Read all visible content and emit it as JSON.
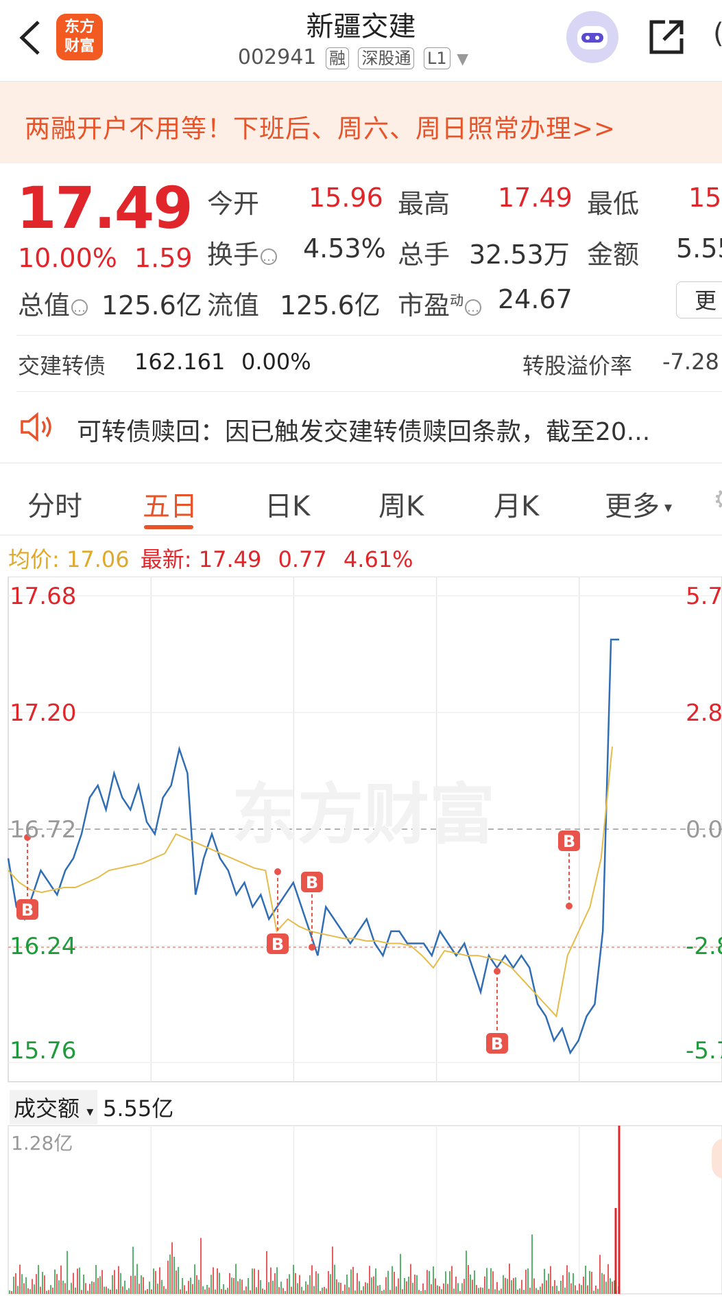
{
  "header": {
    "logo_line1": "东方",
    "logo_line2": "财富",
    "title": "新疆交建",
    "code": "002941",
    "tags": [
      "融",
      "深股通",
      "L1"
    ]
  },
  "banner": {
    "text": "两融开户不用等！下班后、周六、周日照常办理>>"
  },
  "quote": {
    "price": "17.49",
    "change_pct": "10.00%",
    "change": "1.59",
    "open_label": "今开",
    "open": "15.96",
    "high_label": "最高",
    "high": "17.49",
    "low_label": "最低",
    "low": "15",
    "turnover_label": "换手",
    "turnover": "4.53%",
    "volume_label": "总手",
    "volume": "32.53万",
    "amount_label": "金额",
    "amount": "5.55",
    "mktcap_label": "总值",
    "mktcap": "125.6亿",
    "float_label": "流值",
    "float": "125.6亿",
    "pe_label": "市盈",
    "pe_sup": "动",
    "pe": "24.67",
    "more": "更"
  },
  "bond": {
    "name": "交建转债",
    "price": "162.161",
    "pct": "0.00%",
    "premium_label": "转股溢价率",
    "premium": "-7.28"
  },
  "notice": {
    "text": "可转债赎回：因已触发交建转债赎回条款，截至20..."
  },
  "tabs": [
    "分时",
    "五日",
    "日K",
    "周K",
    "月K",
    "更多"
  ],
  "active_tab": "五日",
  "legend": {
    "avg_label": "均价:",
    "avg": "17.06",
    "last_label": "最新:",
    "last": "17.49",
    "chg": "0.77",
    "pct": "4.61%"
  },
  "chart_data": {
    "type": "line",
    "title": "",
    "y_left_ticks": [
      "17.68",
      "17.20",
      "16.72",
      "16.24",
      "15.76"
    ],
    "y_right_ticks": [
      "5.7",
      "2.8",
      "0.0",
      "-2.8",
      "-5.7"
    ],
    "ylim": [
      15.76,
      17.68
    ],
    "prev_close": 16.72,
    "day_count": 5,
    "series": [
      {
        "values": [
          16.6,
          16.4,
          16.35,
          16.45,
          16.55,
          16.5,
          16.45,
          16.55,
          16.6,
          16.7,
          16.85,
          16.9,
          16.8,
          16.95,
          16.85,
          16.8,
          16.9,
          16.75,
          16.7,
          16.85,
          16.9,
          17.05,
          16.95,
          16.45,
          16.6,
          16.7,
          16.6,
          16.55,
          16.45,
          16.5,
          16.4,
          16.45,
          16.35,
          16.4,
          16.45,
          16.5,
          16.4,
          16.3,
          16.2,
          16.4,
          16.35,
          16.3,
          16.25,
          16.3,
          16.35,
          16.25,
          16.2,
          16.3,
          16.3,
          16.25,
          16.25,
          16.25,
          16.2,
          16.3,
          16.25,
          16.2,
          16.25,
          16.15,
          16.05,
          16.2,
          16.15,
          16.2,
          16.15,
          16.2,
          16.15,
          16.0,
          15.95,
          15.85,
          15.9,
          15.8,
          15.85,
          15.95,
          16.0,
          16.3,
          17.5,
          17.5
        ],
        "color": "#2f6db5"
      },
      {
        "values": [
          16.55,
          16.5,
          16.47,
          16.46,
          16.47,
          16.48,
          16.48,
          16.5,
          16.52,
          16.55,
          16.56,
          16.57,
          16.58,
          16.6,
          16.62,
          16.7,
          16.68,
          16.66,
          16.64,
          16.62,
          16.6,
          16.58,
          16.56,
          16.55,
          16.3,
          16.35,
          16.32,
          16.3,
          16.29,
          16.28,
          16.27,
          16.27,
          16.26,
          16.26,
          16.25,
          16.25,
          16.24,
          16.2,
          16.15,
          16.22,
          16.21,
          16.2,
          16.2,
          16.19,
          16.18,
          16.15,
          16.1,
          16.05,
          16.0,
          15.95,
          16.2,
          16.3,
          16.4,
          16.6,
          17.06
        ],
        "color": "#e5bb4a"
      }
    ],
    "markers": [
      {
        "label": "B",
        "day": 0
      },
      {
        "label": "B",
        "day": 1
      },
      {
        "label": "B",
        "day": 2
      },
      {
        "label": "B",
        "day": 3
      },
      {
        "label": "B",
        "day": 3
      }
    ]
  },
  "volume": {
    "label": "成交额",
    "value": "5.55亿",
    "max_tick": "1.28亿"
  },
  "watermark": "东方财富",
  "colors": {
    "up": "#e0262b",
    "down": "#1e9b3b",
    "accent": "#e8542a",
    "price_line": "#2f6db5",
    "avg_line": "#e5bb4a"
  }
}
